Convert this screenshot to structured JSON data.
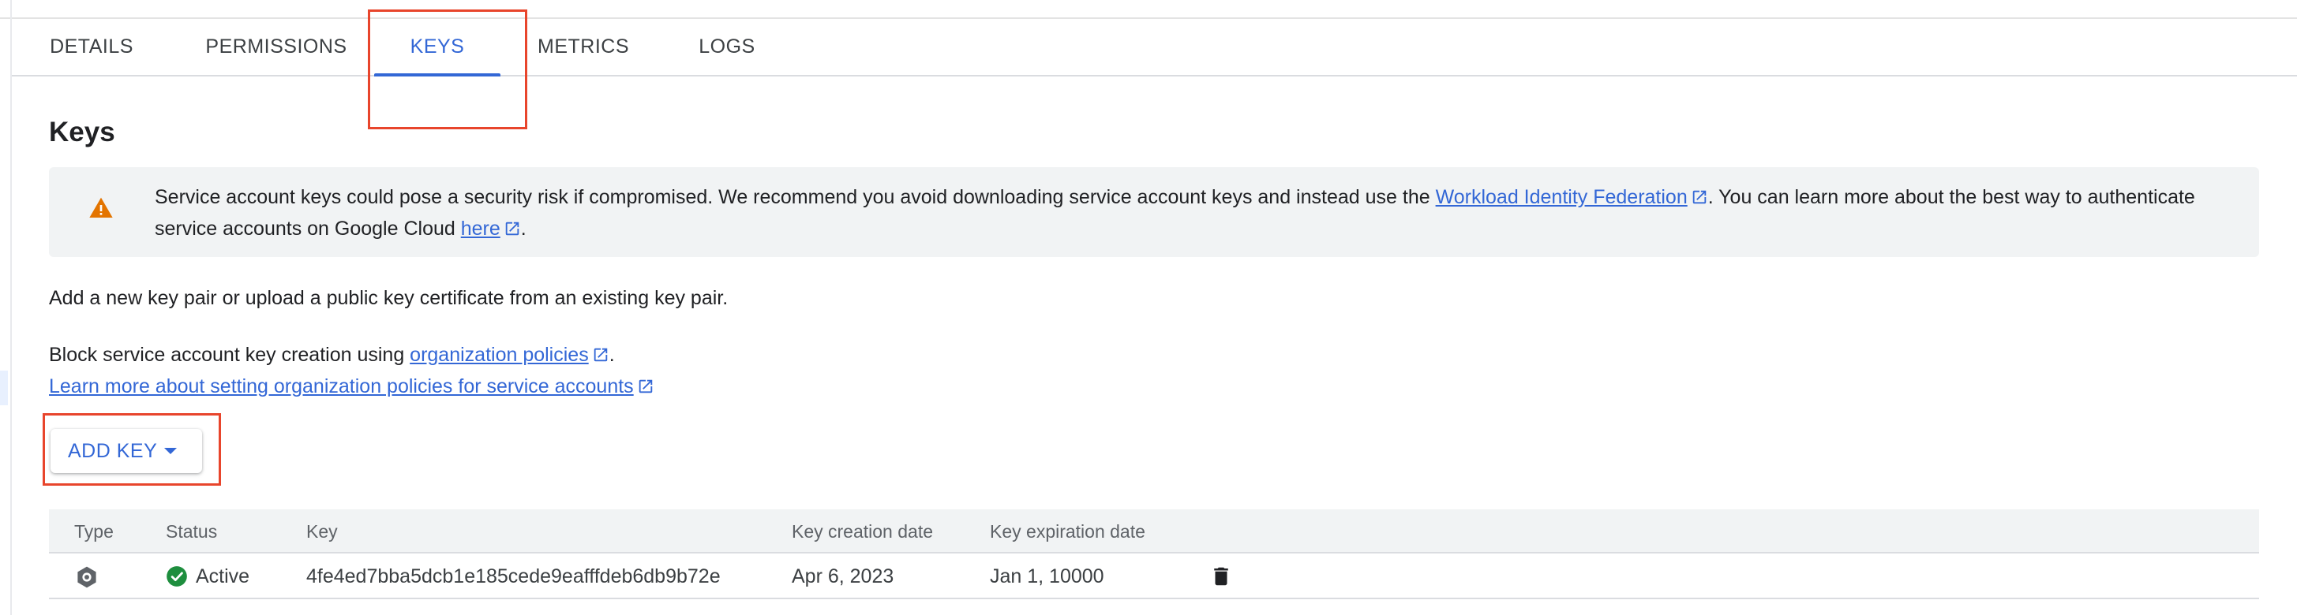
{
  "tabs": [
    {
      "label": "DETAILS",
      "active": false
    },
    {
      "label": "PERMISSIONS",
      "active": false
    },
    {
      "label": "KEYS",
      "active": true
    },
    {
      "label": "METRICS",
      "active": false
    },
    {
      "label": "LOGS",
      "active": false
    }
  ],
  "section": {
    "title": "Keys"
  },
  "warning": {
    "icon": "warning-triangle-icon",
    "text_before": "Service account keys could pose a security risk if compromised. We recommend you avoid downloading service account keys and instead use the ",
    "link1": "Workload Identity Federation",
    "text_middle": ". You can learn more about the best way to authenticate service accounts on Google Cloud ",
    "link2": "here",
    "text_after": "."
  },
  "intro": "Add a new key pair or upload a public key certificate from an existing key pair.",
  "block": {
    "text": "Block service account key creation using ",
    "link": "organization policies",
    "after": "."
  },
  "learn_more_link": "Learn more about setting organization policies for service accounts",
  "add_key_button": {
    "label": "ADD KEY",
    "icon": "caret-down-icon"
  },
  "table": {
    "columns": [
      "Type",
      "Status",
      "Key",
      "Key creation date",
      "Key expiration date"
    ],
    "rows": [
      {
        "type_icon": "gear-key-icon",
        "status": "Active",
        "status_icon": "check-circle-icon",
        "key": "4fe4ed7bba5dcb1e185cede9eafffdeb6db9b72e",
        "created": "Apr 6, 2023",
        "expires": "Jan 1, 10000",
        "action_icon": "delete-icon"
      }
    ]
  },
  "colors": {
    "accent": "#3367d6",
    "annotation": "#e8452c",
    "warning": "#e37400",
    "success": "#1e8e3e"
  }
}
